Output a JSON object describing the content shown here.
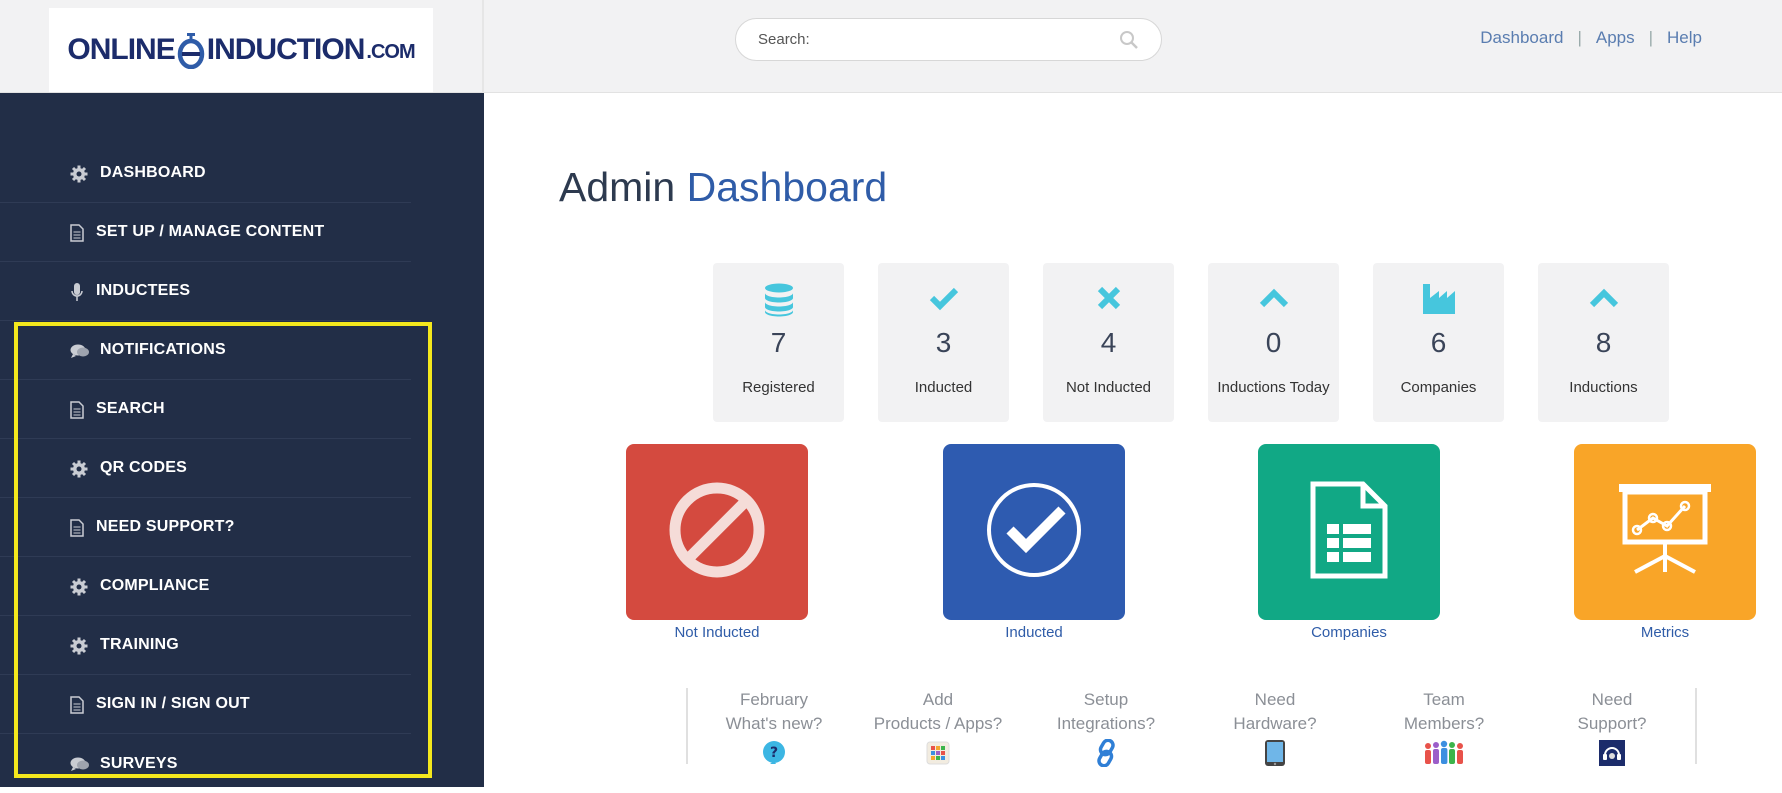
{
  "header": {
    "logo": {
      "word1": "ONLINE",
      "word2": "INDUCTION",
      "suffix": ".COM"
    },
    "search": {
      "placeholder": "Search:"
    },
    "links": {
      "dashboard": "Dashboard",
      "apps": "Apps",
      "help": "Help",
      "separator": "|"
    }
  },
  "sidebar": {
    "items": [
      {
        "label": "DASHBOARD",
        "icon": "gear-icon"
      },
      {
        "label": "SET UP / MANAGE CONTENT",
        "icon": "document-icon"
      },
      {
        "label": "INDUCTEES",
        "icon": "microphone-icon"
      },
      {
        "label": "NOTIFICATIONS",
        "icon": "chat-icon"
      },
      {
        "label": "SEARCH",
        "icon": "document-icon"
      },
      {
        "label": "QR CODES",
        "icon": "gear-icon"
      },
      {
        "label": "NEED SUPPORT?",
        "icon": "document-icon"
      },
      {
        "label": "COMPLIANCE",
        "icon": "gear-icon"
      },
      {
        "label": "TRAINING",
        "icon": "gear-icon"
      },
      {
        "label": "SIGN IN / SIGN OUT",
        "icon": "document-icon"
      },
      {
        "label": "SURVEYS",
        "icon": "chat-icon"
      }
    ],
    "highlight_color": "#f4e81d"
  },
  "main": {
    "title_prefix": "Admin",
    "title_accent": "Dashboard",
    "stats": [
      {
        "value": "7",
        "label": "Registered",
        "icon": "database-icon"
      },
      {
        "value": "3",
        "label": "Inducted",
        "icon": "check-icon"
      },
      {
        "value": "4",
        "label": "Not Inducted",
        "icon": "x-icon"
      },
      {
        "value": "0",
        "label": "Inductions Today",
        "icon": "chevron-up-icon"
      },
      {
        "value": "6",
        "label": "Companies",
        "icon": "factory-icon"
      },
      {
        "value": "8",
        "label": "Inductions",
        "icon": "chevron-up-icon"
      }
    ],
    "tiles": [
      {
        "label": "Not Inducted",
        "color": "#d44a3f",
        "icon": "prohibited-icon"
      },
      {
        "label": "Inducted",
        "color": "#2e5bb0",
        "icon": "check-circle-icon"
      },
      {
        "label": "Companies",
        "color": "#11a885",
        "icon": "spreadsheet-icon"
      },
      {
        "label": "Metrics",
        "color": "#f9a528",
        "icon": "presentation-chart-icon"
      }
    ],
    "bottom": [
      {
        "line1": "February",
        "line2": "What's new?",
        "icon": "question-bubble-icon"
      },
      {
        "line1": "Add",
        "line2": "Products / Apps?",
        "icon": "apps-grid-icon"
      },
      {
        "line1": "Setup",
        "line2": "Integrations?",
        "icon": "link-icon"
      },
      {
        "line1": "Need",
        "line2": "Hardware?",
        "icon": "tablet-icon"
      },
      {
        "line1": "Team",
        "line2": "Members?",
        "icon": "team-icon"
      },
      {
        "line1": "Need",
        "line2": "Support?",
        "icon": "headset-icon"
      }
    ]
  }
}
